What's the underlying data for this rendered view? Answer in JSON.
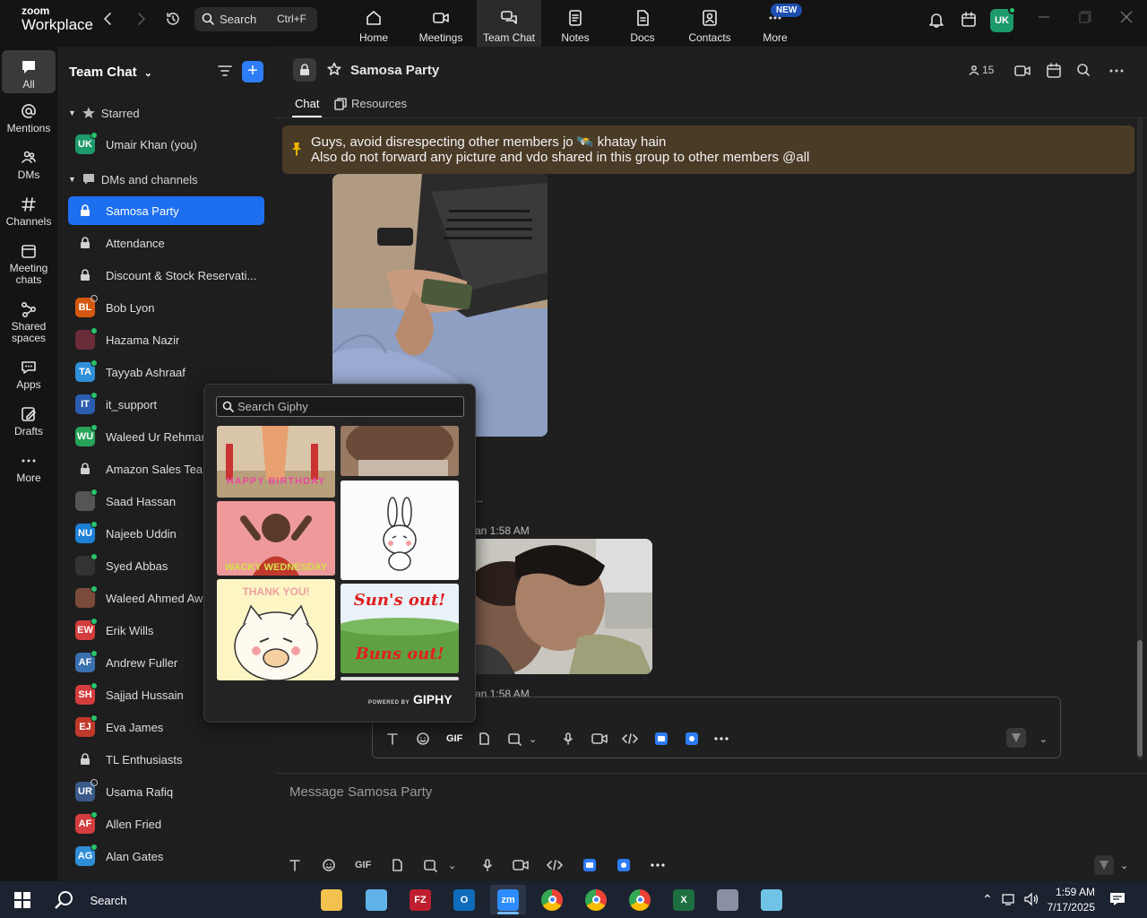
{
  "app": {
    "logo_top": "zoom",
    "logo_bottom": "Workplace"
  },
  "topbar": {
    "search_label": "Search",
    "search_shortcut": "Ctrl+F",
    "tabs": [
      {
        "label": "Home",
        "icon": "home-icon"
      },
      {
        "label": "Meetings",
        "icon": "video-camera-icon"
      },
      {
        "label": "Team Chat",
        "icon": "chat-bubbles-icon",
        "active": true
      },
      {
        "label": "Notes",
        "icon": "notes-icon"
      },
      {
        "label": "Docs",
        "icon": "docs-icon"
      },
      {
        "label": "Contacts",
        "icon": "contacts-icon"
      },
      {
        "label": "More",
        "icon": "more-icon"
      }
    ],
    "new_badge": "NEW",
    "avatar_initials": "UK"
  },
  "rail": [
    {
      "label": "All",
      "icon": "chat-bubble-icon",
      "active": true
    },
    {
      "label": "Mentions",
      "icon": "at-icon"
    },
    {
      "label": "DMs",
      "icon": "people-icon"
    },
    {
      "label": "Channels",
      "icon": "hash-icon"
    },
    {
      "label": "Meeting",
      "label2": "chats",
      "icon": "calendar-icon"
    },
    {
      "label": "Shared",
      "label2": "spaces",
      "icon": "share-icon"
    },
    {
      "label": "Apps",
      "icon": "apps-icon"
    },
    {
      "label": "Drafts",
      "icon": "drafts-icon"
    },
    {
      "label": "More",
      "icon": "ellipsis-icon"
    }
  ],
  "sidebar": {
    "title": "Team Chat",
    "starred_label": "Starred",
    "dms_label": "DMs and channels",
    "starred_items": [
      {
        "label": "Umair Khan (you)",
        "initials": "UK",
        "color": "#1d9a6c",
        "status": "online"
      }
    ],
    "items": [
      {
        "label": "Samosa Party",
        "type": "lock",
        "active": true
      },
      {
        "label": "Attendance",
        "type": "lock"
      },
      {
        "label": "Discount & Stock Reservati...",
        "type": "lock"
      },
      {
        "label": "Bob Lyon",
        "initials": "BL",
        "color": "#d4580f",
        "status": "away"
      },
      {
        "label": "Hazama Nazir",
        "initials": "",
        "color": "#6b2c3a",
        "status": "online"
      },
      {
        "label": "Tayyab Ashraaf",
        "initials": "TA",
        "color": "#2f8fd8",
        "status": "online"
      },
      {
        "label": "it_support",
        "initials": "IT",
        "color": "#2a5db0",
        "status": "mobile"
      },
      {
        "label": "Waleed Ur Rehman",
        "initials": "WU",
        "color": "#27a35a",
        "status": "online"
      },
      {
        "label": "Amazon Sales Team",
        "type": "lock"
      },
      {
        "label": "Saad Hassan",
        "initials": "",
        "color": "#555555",
        "status": "online"
      },
      {
        "label": "Najeeb Uddin",
        "initials": "NU",
        "color": "#1e7fd6",
        "status": "online"
      },
      {
        "label": "Syed Abbas",
        "initials": "",
        "color": "#333333",
        "status": "online"
      },
      {
        "label": "Waleed Ahmed Awan",
        "initials": "",
        "color": "#7a4a3a",
        "status": "online"
      },
      {
        "label": "Erik Wills",
        "initials": "EW",
        "color": "#d43d3d",
        "status": "online"
      },
      {
        "label": "Andrew Fuller",
        "initials": "AF",
        "color": "#3a6fb0",
        "status": "online"
      },
      {
        "label": "Sajjad Hussain",
        "initials": "SH",
        "color": "#d43d3d",
        "status": "online"
      },
      {
        "label": "Eva James",
        "initials": "EJ",
        "color": "#c0392b",
        "status": "online"
      },
      {
        "label": "TL Enthusiasts",
        "type": "lock"
      },
      {
        "label": "Usama Rafiq",
        "initials": "UR",
        "color": "#3a5a8a",
        "status": "away"
      },
      {
        "label": "Allen Fried",
        "initials": "AF",
        "color": "#d43d3d",
        "status": "online"
      },
      {
        "label": "Alan Gates",
        "initials": "AG",
        "color": "#2e8fd8",
        "status": "online"
      }
    ]
  },
  "channel": {
    "name": "Samosa Party",
    "member_count": "15",
    "tabs": {
      "chat": "Chat",
      "resources": "Resources"
    },
    "pinned_line1": "Guys, avoid disrespecting other members jo 🛰️ khatay hain",
    "pinned_line2": "Also do not forward any picture and vdo shared in this group to other members @all",
    "msg_time_1": "an 1:58 AM",
    "msg_time_2": "an 1:58 AM",
    "ellipsis": "...",
    "composer_placeholder": "Message Samosa Party"
  },
  "gif_picker": {
    "search_placeholder": "Search Giphy",
    "powered_by": "POWERED BY",
    "brand": "GIPHY",
    "gifs": [
      {
        "caption": "HAPPY BIRTHDAY"
      },
      {
        "caption": ""
      },
      {
        "caption": "WACKY WEDNESDAY"
      },
      {
        "caption": ""
      },
      {
        "caption": "THANK YOU!"
      },
      {
        "caption": "Sun's out!",
        "caption2": "Buns out!"
      }
    ]
  },
  "taskbar": {
    "search_label": "Search",
    "time": "1:59 AM",
    "date": "7/17/2025",
    "apps": [
      {
        "name": "file-explorer-icon",
        "color": "#f2c14e"
      },
      {
        "name": "app-diamond-icon",
        "color": "#5fb3e8"
      },
      {
        "name": "filezilla-icon",
        "color": "#bf1e2e",
        "text": "FZ"
      },
      {
        "name": "outlook-icon",
        "color": "#0f6cbd",
        "text": "O"
      },
      {
        "name": "zoom-icon",
        "color": "#2d8cff",
        "text": "zm",
        "active": true
      },
      {
        "name": "chrome-icon",
        "color": "#e94235"
      },
      {
        "name": "chrome-icon",
        "color": "#e94235"
      },
      {
        "name": "chrome-icon",
        "color": "#e94235"
      },
      {
        "name": "excel-icon",
        "color": "#1d6f42",
        "text": "X"
      },
      {
        "name": "calculator-icon",
        "color": "#8a8fa3"
      },
      {
        "name": "notepad-icon",
        "color": "#6ec3e6"
      }
    ]
  }
}
